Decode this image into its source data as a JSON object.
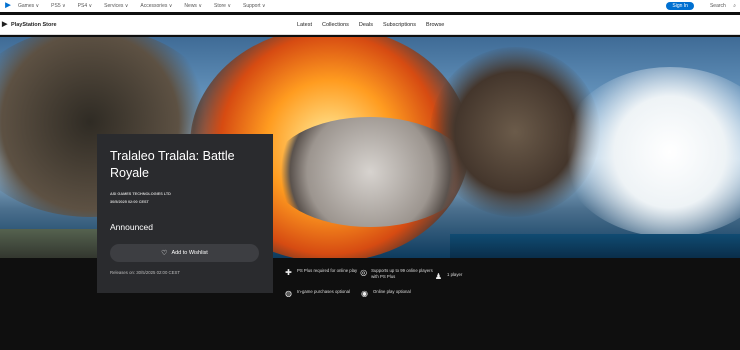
{
  "topnav": {
    "items": [
      "Games ∨",
      "PS5 ∨",
      "PS4 ∨",
      "Services ∨",
      "Accessories ∨",
      "News ∨",
      "Store ∨",
      "Support ∨"
    ],
    "signin_label": "Sign In",
    "search_label": "Search"
  },
  "store": {
    "logo_label": "PlayStation Store",
    "nav": [
      "Latest",
      "Collections",
      "Deals",
      "Subscriptions",
      "Browse"
    ]
  },
  "game": {
    "title": "Tralaleo Tralala: Battle Royale",
    "publisher": "ASI GAMES TECHNOLOGIES LTD",
    "datetime": "30/5/2025 02:00 CEST",
    "status": "Announced",
    "wishlist_label": "Add to Wishlist",
    "release": "Releases on: 30/5/2025 02:00 CEST"
  },
  "features": [
    {
      "icon": "ps-plus-icon",
      "text": "PS Plus required for online play"
    },
    {
      "icon": "online-players-icon",
      "text": "Supports up to 99 online players with PS Plus"
    },
    {
      "icon": "player-icon",
      "text": "1 player"
    },
    {
      "icon": "in-game-purchase-icon",
      "text": "In-game purchases optional"
    },
    {
      "icon": "online-play-icon",
      "text": "Online play optional"
    }
  ],
  "colors": {
    "accent": "#0070d1",
    "card": "#2a2b2e",
    "background": "#0f0f0f"
  }
}
